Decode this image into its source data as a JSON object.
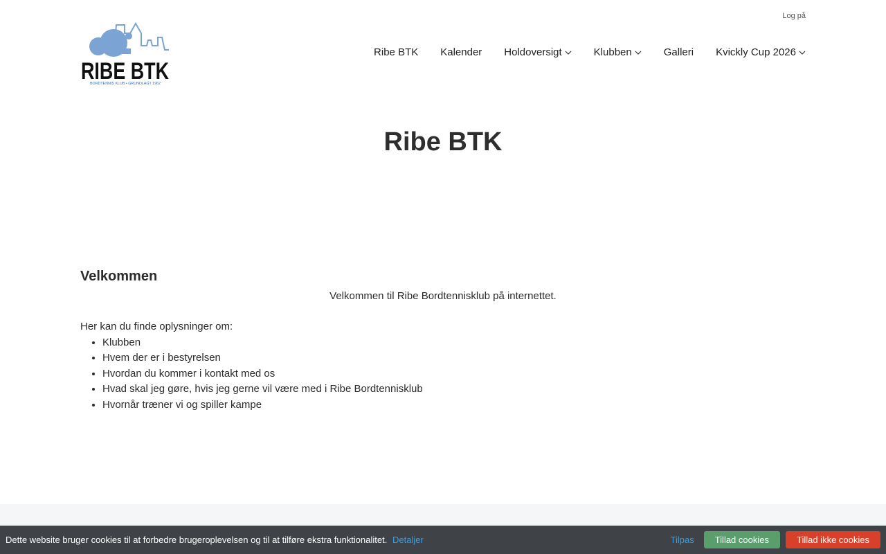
{
  "header": {
    "login_label": "Log på",
    "logo_text": "RIBE BTK",
    "logo_subtext": "BORDTENNIS KLUB • GRUNDLAGT 1962"
  },
  "nav": {
    "items": [
      {
        "label": "Ribe BTK",
        "has_dropdown": false
      },
      {
        "label": "Kalender",
        "has_dropdown": false
      },
      {
        "label": "Holdoversigt",
        "has_dropdown": true
      },
      {
        "label": "Klubben",
        "has_dropdown": true
      },
      {
        "label": "Galleri",
        "has_dropdown": false
      },
      {
        "label": "Kvickly Cup 2026",
        "has_dropdown": true
      }
    ]
  },
  "page": {
    "title": "Ribe BTK"
  },
  "content": {
    "heading": "Velkommen",
    "welcome_line": "Velkommen til Ribe Bordtennisklub på internettet.",
    "intro": "Her kan du finde oplysninger om:",
    "list": [
      "Klubben",
      "Hvem der er i bestyrelsen",
      "Hvordan du kommer i kontakt med os",
      "Hvad skal jeg gøre, hvis jeg gerne vil være med i Ribe Bordtennisklub",
      "Hvornår træner vi og spiller kampe"
    ]
  },
  "cookie": {
    "text": "Dette website bruger cookies til at forbedre brugeroplevelsen og til at tilføre ekstra funktionalitet.",
    "details_label": "Detaljer",
    "customize_label": "Tilpas",
    "allow_label": "Tillad cookies",
    "deny_label": "Tillad ikke cookies"
  },
  "colors": {
    "logo_blue": "#7ba4d4",
    "logo_black": "#111111",
    "cookie_bar": "#3f4247",
    "link_blue": "#33a0e8",
    "allow_green": "#5a9e6b",
    "deny_red": "#d9402a"
  }
}
